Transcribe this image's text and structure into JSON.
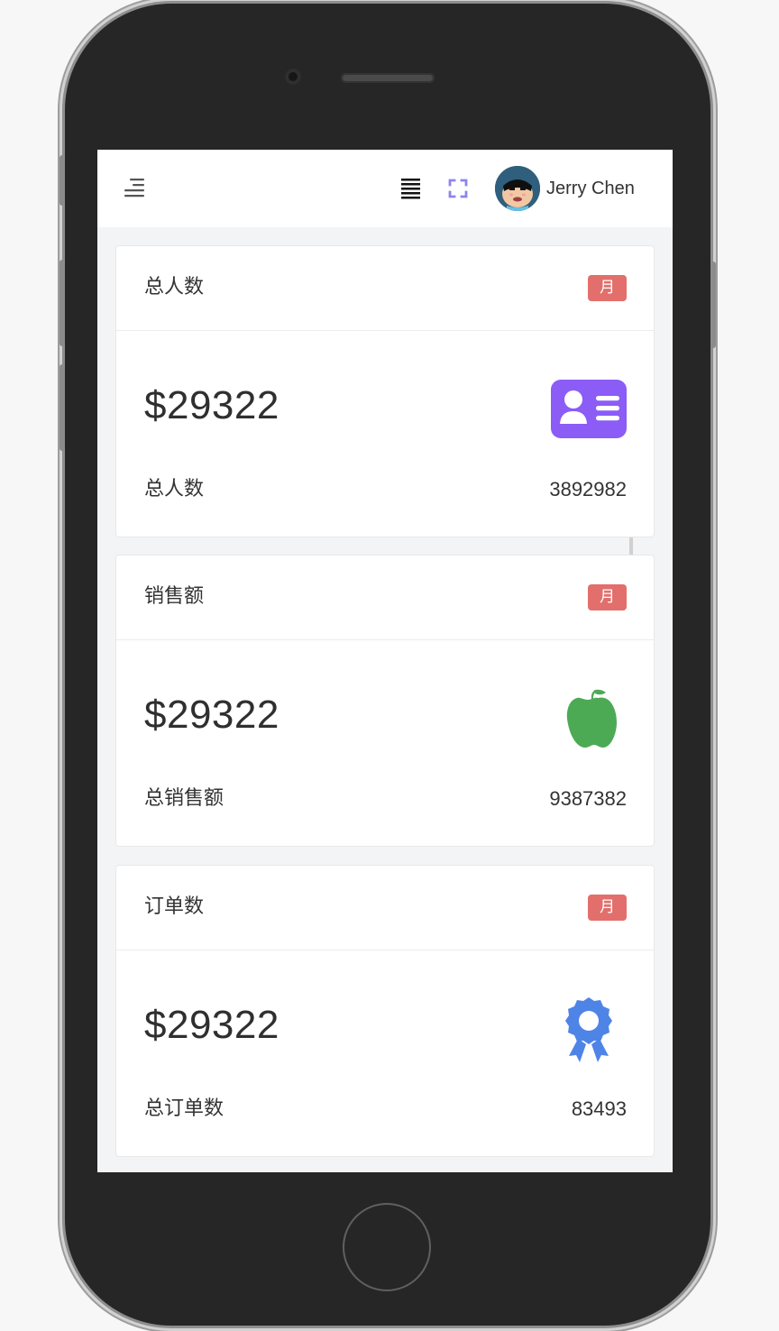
{
  "header": {
    "user_name": "Jerry Chen"
  },
  "cards": [
    {
      "title": "总人数",
      "tag": "月",
      "value": "$29322",
      "footer_label": "总人数",
      "footer_value": "3892982",
      "icon": "id-card-icon",
      "icon_color": "#8b5cf6"
    },
    {
      "title": "销售额",
      "tag": "月",
      "value": "$29322",
      "footer_label": "总销售额",
      "footer_value": "9387382",
      "icon": "apple-icon",
      "icon_color": "#4caa55"
    },
    {
      "title": "订单数",
      "tag": "月",
      "value": "$29322",
      "footer_label": "总订单数",
      "footer_value": "83493",
      "icon": "award-icon",
      "icon_color": "#4f84e7"
    }
  ],
  "colors": {
    "tag": "#e26f6b",
    "menu_icon": "#7f70f5",
    "background": "#f3f4f6"
  }
}
